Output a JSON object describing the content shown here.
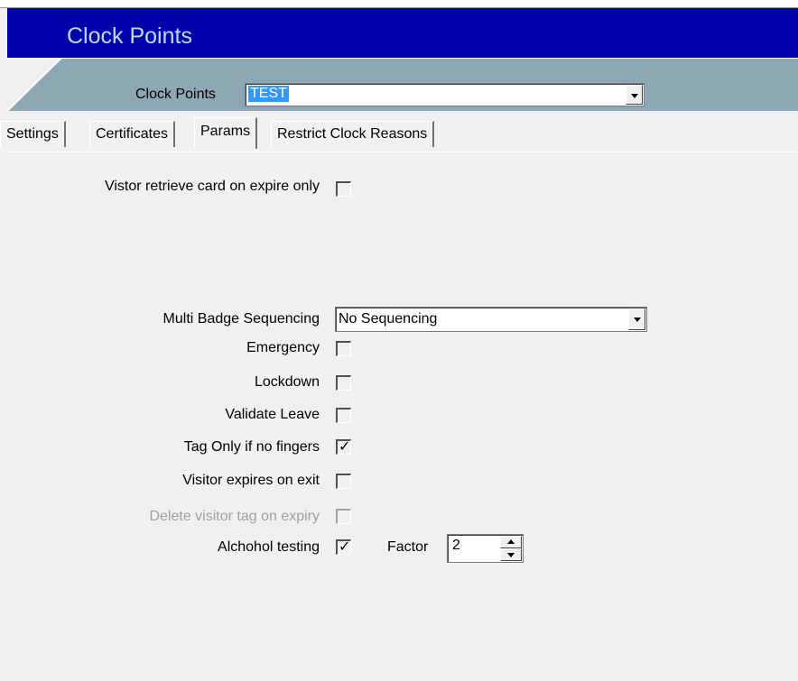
{
  "header": {
    "title": "Clock Points"
  },
  "selector": {
    "label": "Clock Points",
    "value": "TEST"
  },
  "tabs": [
    {
      "label": "Settings",
      "active": false
    },
    {
      "label": "Certificates",
      "active": false
    },
    {
      "label": "Params",
      "active": true
    },
    {
      "label": "Restrict Clock Reasons",
      "active": false
    }
  ],
  "params": {
    "visitor_retrieve_card": {
      "label": "Vistor retrieve card on expire only",
      "checked": false
    },
    "multi_badge": {
      "label": "Multi Badge Sequencing",
      "value": "No Sequencing"
    },
    "emergency": {
      "label": "Emergency",
      "checked": false
    },
    "lockdown": {
      "label": "Lockdown",
      "checked": false
    },
    "validate_leave": {
      "label": "Validate Leave",
      "checked": false
    },
    "tag_only": {
      "label": "Tag Only if no fingers",
      "checked": true
    },
    "visitor_expires": {
      "label": "Visitor expires on exit",
      "checked": false
    },
    "delete_visitor_tag": {
      "label": "Delete visitor tag on expiry",
      "checked": false,
      "disabled": true
    },
    "alcohol_testing": {
      "label": "Alchohol testing",
      "checked": true
    },
    "factor": {
      "label": "Factor",
      "value": "2"
    }
  },
  "colors": {
    "banner": "#0000a8",
    "title": "#b7dcff",
    "greybar": "#8da7b4",
    "selection": "#3399ff"
  },
  "icons": {
    "checkmark": "check-icon",
    "dropdown": "chevron-down-icon",
    "spin_up": "arrow-up-icon",
    "spin_down": "arrow-down-icon"
  }
}
